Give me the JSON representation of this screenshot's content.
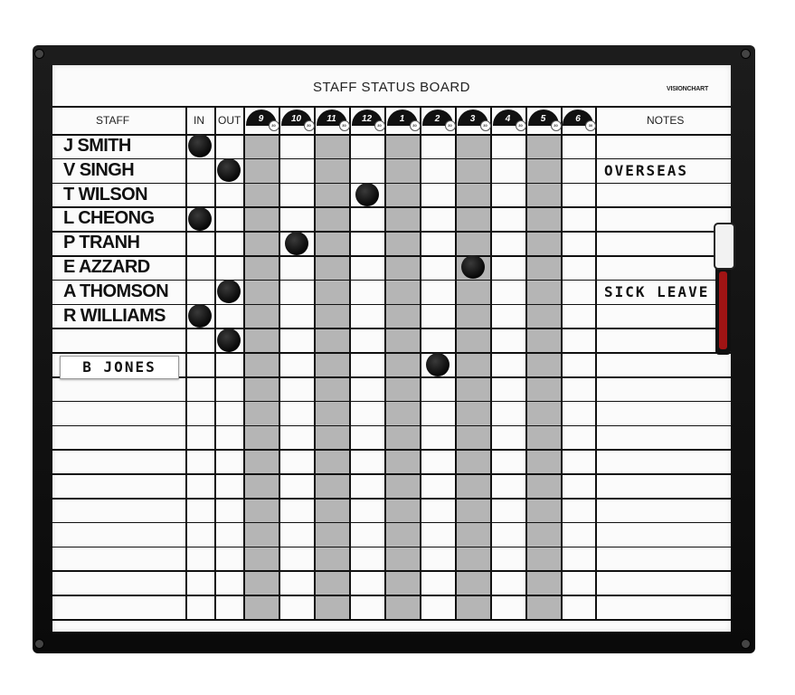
{
  "board": {
    "title": "STAFF STATUS BOARD",
    "brand": "VISIONCHART"
  },
  "headers": {
    "staff": "STAFF",
    "in": "IN",
    "out": "OUT",
    "notes": "NOTES",
    "hours": [
      "9",
      "10",
      "11",
      "12",
      "1",
      "2",
      "3",
      "4",
      "5",
      "6"
    ],
    "half_hour": "30"
  },
  "staff": [
    {
      "name": "J SMITH",
      "status": "IN",
      "note": ""
    },
    {
      "name": "V SINGH",
      "status": "OUT",
      "note": "OVERSEAS"
    },
    {
      "name": "T WILSON",
      "status": "12",
      "note": ""
    },
    {
      "name": "L CHEONG",
      "status": "IN",
      "note": ""
    },
    {
      "name": "P TRANH",
      "status": "10",
      "note": ""
    },
    {
      "name": "E AZZARD",
      "status": "3",
      "note": ""
    },
    {
      "name": "A THOMSON",
      "status": "OUT",
      "note": "SICK LEAVE"
    },
    {
      "name": "R WILLIAMS",
      "status": "IN",
      "note": ""
    },
    {
      "name": "",
      "status": "OUT",
      "note": ""
    },
    {
      "name": "B JONES",
      "status": "2",
      "note": ""
    }
  ],
  "total_rows": 20,
  "colors": {
    "frame": "#111111",
    "board": "#fbfbfb",
    "band": "#b5b5b5",
    "magnet": "#0a0a0a"
  }
}
